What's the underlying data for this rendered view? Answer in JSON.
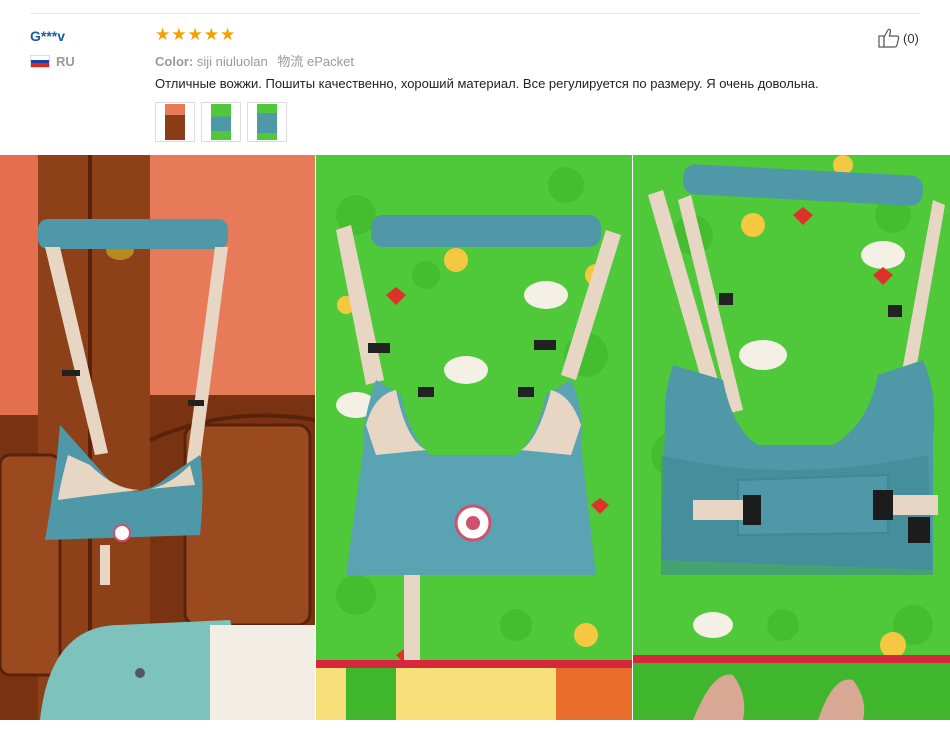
{
  "review": {
    "username": "G***v",
    "country": "RU",
    "rating": 5,
    "color_label": "Color:",
    "color_value": "siji niuluolan",
    "logistics_label": "物流",
    "logistics_value": "ePacket",
    "text": "Отличные вожжи. Пошиты качественно, хороший материал. Все регулируется по размеру. Я очень довольна.",
    "helpful_count": "(0)"
  },
  "icons": {
    "star": "star-icon",
    "thumbs_up": "thumbs-up-icon",
    "flag": "russia-flag-icon"
  },
  "colors": {
    "username": "#1a5aa6",
    "star": "#f4a000",
    "muted": "#999999",
    "harness_blue": "#4f98a8",
    "strap_beige": "#e8d6c4",
    "wood": "#8a3b18",
    "wall": "#e77a58",
    "mat_green": "#4fc83a"
  }
}
